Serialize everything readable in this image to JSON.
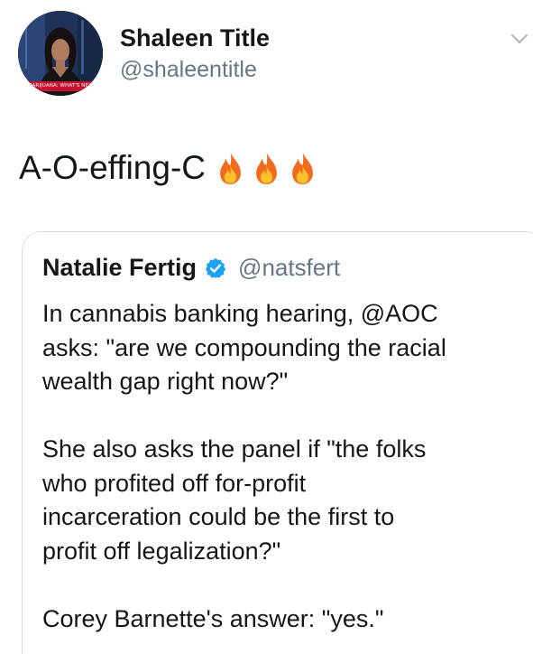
{
  "tweet": {
    "author": {
      "display_name": "Shaleen Title",
      "handle": "@shaleentitle",
      "avatar_caption": "MARIJUANA: WHAT'S NEXT"
    },
    "text": "A-O-effing-C",
    "emojis": [
      "fire-icon",
      "fire-icon",
      "fire-icon"
    ],
    "menu_icon": "chevron-down-icon"
  },
  "quoted_tweet": {
    "author": {
      "display_name": "Natalie Fertig",
      "verified_icon": "verified-badge-icon",
      "handle": "@natsfert"
    },
    "paragraphs": [
      "In cannabis banking hearing, @AOC\nasks: \"are we compounding the racial\nwealth gap right now?\"",
      "She also asks the panel if \"the folks\nwho profited off for-profit\nincarceration could be the first to\nprofit off legalization?\"",
      "Corey Barnette's answer: \"yes.\""
    ]
  },
  "colors": {
    "text_primary": "#14171a",
    "text_secondary": "#657786",
    "verified_blue": "#1da1f2",
    "quote_border": "#d8dee3",
    "avatar_caption_red": "#c7122f"
  }
}
